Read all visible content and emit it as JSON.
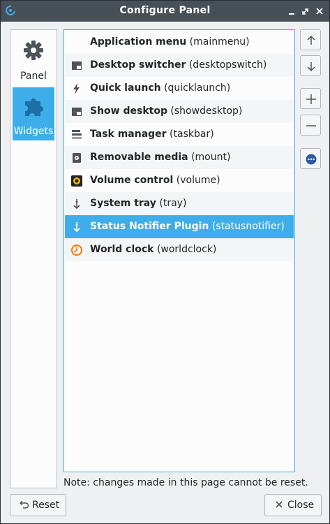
{
  "window": {
    "title": "Configure Panel"
  },
  "sidebar": {
    "items": [
      {
        "label": "Panel",
        "icon": "gear-icon",
        "selected": false
      },
      {
        "label": "Widgets",
        "icon": "puzzle-icon",
        "selected": true
      }
    ]
  },
  "widgets": {
    "items": [
      {
        "name": "Application menu",
        "id": "(mainmenu)",
        "icon": "application-menu-icon"
      },
      {
        "name": "Desktop switcher",
        "id": "(desktopswitch)",
        "icon": "desktop-switcher-icon"
      },
      {
        "name": "Quick launch",
        "id": "(quicklaunch)",
        "icon": "lightning-icon"
      },
      {
        "name": "Show desktop",
        "id": "(showdesktop)",
        "icon": "show-desktop-icon"
      },
      {
        "name": "Task manager",
        "id": "(taskbar)",
        "icon": "task-manager-icon"
      },
      {
        "name": "Removable media",
        "id": "(mount)",
        "icon": "removable-media-icon"
      },
      {
        "name": "Volume control",
        "id": "(volume)",
        "icon": "volume-control-icon"
      },
      {
        "name": "System tray",
        "id": "(tray)",
        "icon": "system-tray-icon"
      },
      {
        "name": "Status Notifier Plugin",
        "id": "(statusnotifier)",
        "icon": "status-notifier-icon",
        "selected": true
      },
      {
        "name": "World clock",
        "id": "(worldclock)",
        "icon": "clock-icon"
      }
    ]
  },
  "note": "Note: changes made in this page cannot be reset.",
  "buttons": {
    "reset": "Reset",
    "close": "Close"
  },
  "colors": {
    "accent": "#3daee9",
    "titlebar": "#475057",
    "background": "#eff0f1"
  }
}
